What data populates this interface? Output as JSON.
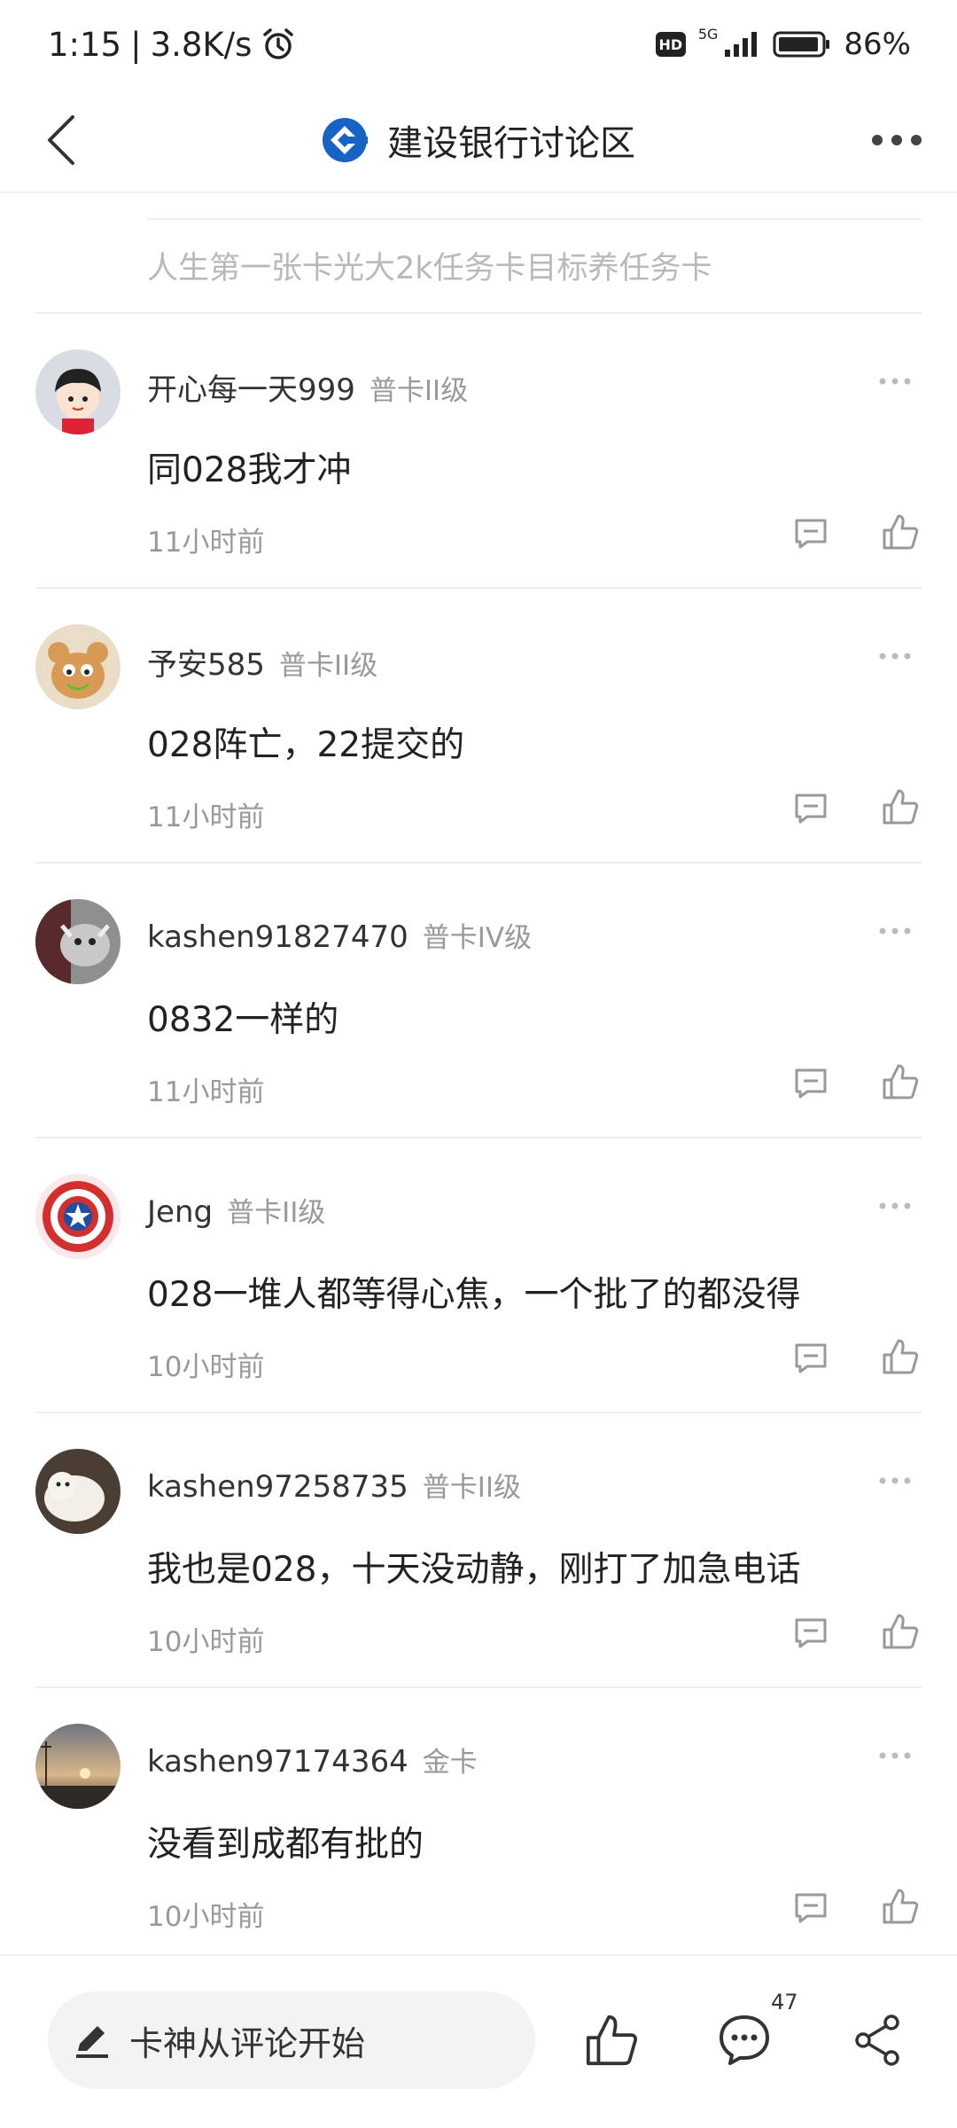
{
  "status_bar": {
    "time": "1:15",
    "net_speed": "3.8K/s",
    "hd": "HD",
    "network": "5G",
    "battery": "86%"
  },
  "header": {
    "title": "建设银行讨论区",
    "brand_color": "#1763c5"
  },
  "reply_preview": "人生第一张卡光大2k任务卡目标养任务卡",
  "comments": [
    {
      "username": "开心每一天999",
      "level": "普卡II级",
      "text": "同028我才冲",
      "time": "11小时前"
    },
    {
      "username": "予安585",
      "level": "普卡II级",
      "text": "028阵亡，22提交的",
      "time": "11小时前"
    },
    {
      "username": "kashen91827470",
      "level": "普卡IV级",
      "text": "0832一样的",
      "time": "11小时前"
    },
    {
      "username": "Jeng",
      "level": "普卡II级",
      "text": "028一堆人都等得心焦，一个批了的都没得",
      "time": "10小时前"
    },
    {
      "username": "kashen97258735",
      "level": "普卡II级",
      "text": "我也是028，十天没动静，刚打了加急电话",
      "time": "10小时前"
    },
    {
      "username": "kashen97174364",
      "level": "金卡",
      "text": "没看到成都有批的",
      "time": "10小时前"
    }
  ],
  "bottom_bar": {
    "input_placeholder": "卡神从评论开始",
    "comment_count": "47"
  }
}
